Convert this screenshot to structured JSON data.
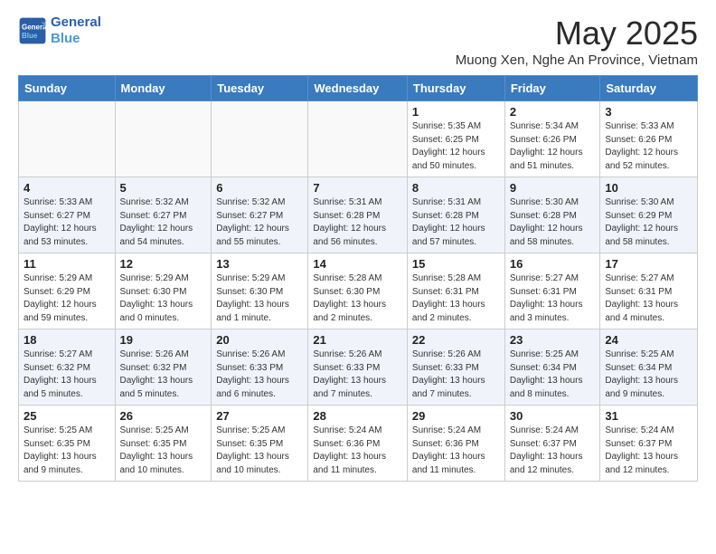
{
  "header": {
    "logo_line1": "General",
    "logo_line2": "Blue",
    "month_title": "May 2025",
    "subtitle": "Muong Xen, Nghe An Province, Vietnam"
  },
  "weekdays": [
    "Sunday",
    "Monday",
    "Tuesday",
    "Wednesday",
    "Thursday",
    "Friday",
    "Saturday"
  ],
  "weeks": [
    [
      {
        "day": "",
        "info": ""
      },
      {
        "day": "",
        "info": ""
      },
      {
        "day": "",
        "info": ""
      },
      {
        "day": "",
        "info": ""
      },
      {
        "day": "1",
        "info": "Sunrise: 5:35 AM\nSunset: 6:25 PM\nDaylight: 12 hours\nand 50 minutes."
      },
      {
        "day": "2",
        "info": "Sunrise: 5:34 AM\nSunset: 6:26 PM\nDaylight: 12 hours\nand 51 minutes."
      },
      {
        "day": "3",
        "info": "Sunrise: 5:33 AM\nSunset: 6:26 PM\nDaylight: 12 hours\nand 52 minutes."
      }
    ],
    [
      {
        "day": "4",
        "info": "Sunrise: 5:33 AM\nSunset: 6:27 PM\nDaylight: 12 hours\nand 53 minutes."
      },
      {
        "day": "5",
        "info": "Sunrise: 5:32 AM\nSunset: 6:27 PM\nDaylight: 12 hours\nand 54 minutes."
      },
      {
        "day": "6",
        "info": "Sunrise: 5:32 AM\nSunset: 6:27 PM\nDaylight: 12 hours\nand 55 minutes."
      },
      {
        "day": "7",
        "info": "Sunrise: 5:31 AM\nSunset: 6:28 PM\nDaylight: 12 hours\nand 56 minutes."
      },
      {
        "day": "8",
        "info": "Sunrise: 5:31 AM\nSunset: 6:28 PM\nDaylight: 12 hours\nand 57 minutes."
      },
      {
        "day": "9",
        "info": "Sunrise: 5:30 AM\nSunset: 6:28 PM\nDaylight: 12 hours\nand 58 minutes."
      },
      {
        "day": "10",
        "info": "Sunrise: 5:30 AM\nSunset: 6:29 PM\nDaylight: 12 hours\nand 58 minutes."
      }
    ],
    [
      {
        "day": "11",
        "info": "Sunrise: 5:29 AM\nSunset: 6:29 PM\nDaylight: 12 hours\nand 59 minutes."
      },
      {
        "day": "12",
        "info": "Sunrise: 5:29 AM\nSunset: 6:30 PM\nDaylight: 13 hours\nand 0 minutes."
      },
      {
        "day": "13",
        "info": "Sunrise: 5:29 AM\nSunset: 6:30 PM\nDaylight: 13 hours\nand 1 minute."
      },
      {
        "day": "14",
        "info": "Sunrise: 5:28 AM\nSunset: 6:30 PM\nDaylight: 13 hours\nand 2 minutes."
      },
      {
        "day": "15",
        "info": "Sunrise: 5:28 AM\nSunset: 6:31 PM\nDaylight: 13 hours\nand 2 minutes."
      },
      {
        "day": "16",
        "info": "Sunrise: 5:27 AM\nSunset: 6:31 PM\nDaylight: 13 hours\nand 3 minutes."
      },
      {
        "day": "17",
        "info": "Sunrise: 5:27 AM\nSunset: 6:31 PM\nDaylight: 13 hours\nand 4 minutes."
      }
    ],
    [
      {
        "day": "18",
        "info": "Sunrise: 5:27 AM\nSunset: 6:32 PM\nDaylight: 13 hours\nand 5 minutes."
      },
      {
        "day": "19",
        "info": "Sunrise: 5:26 AM\nSunset: 6:32 PM\nDaylight: 13 hours\nand 5 minutes."
      },
      {
        "day": "20",
        "info": "Sunrise: 5:26 AM\nSunset: 6:33 PM\nDaylight: 13 hours\nand 6 minutes."
      },
      {
        "day": "21",
        "info": "Sunrise: 5:26 AM\nSunset: 6:33 PM\nDaylight: 13 hours\nand 7 minutes."
      },
      {
        "day": "22",
        "info": "Sunrise: 5:26 AM\nSunset: 6:33 PM\nDaylight: 13 hours\nand 7 minutes."
      },
      {
        "day": "23",
        "info": "Sunrise: 5:25 AM\nSunset: 6:34 PM\nDaylight: 13 hours\nand 8 minutes."
      },
      {
        "day": "24",
        "info": "Sunrise: 5:25 AM\nSunset: 6:34 PM\nDaylight: 13 hours\nand 9 minutes."
      }
    ],
    [
      {
        "day": "25",
        "info": "Sunrise: 5:25 AM\nSunset: 6:35 PM\nDaylight: 13 hours\nand 9 minutes."
      },
      {
        "day": "26",
        "info": "Sunrise: 5:25 AM\nSunset: 6:35 PM\nDaylight: 13 hours\nand 10 minutes."
      },
      {
        "day": "27",
        "info": "Sunrise: 5:25 AM\nSunset: 6:35 PM\nDaylight: 13 hours\nand 10 minutes."
      },
      {
        "day": "28",
        "info": "Sunrise: 5:24 AM\nSunset: 6:36 PM\nDaylight: 13 hours\nand 11 minutes."
      },
      {
        "day": "29",
        "info": "Sunrise: 5:24 AM\nSunset: 6:36 PM\nDaylight: 13 hours\nand 11 minutes."
      },
      {
        "day": "30",
        "info": "Sunrise: 5:24 AM\nSunset: 6:37 PM\nDaylight: 13 hours\nand 12 minutes."
      },
      {
        "day": "31",
        "info": "Sunrise: 5:24 AM\nSunset: 6:37 PM\nDaylight: 13 hours\nand 12 minutes."
      }
    ]
  ]
}
